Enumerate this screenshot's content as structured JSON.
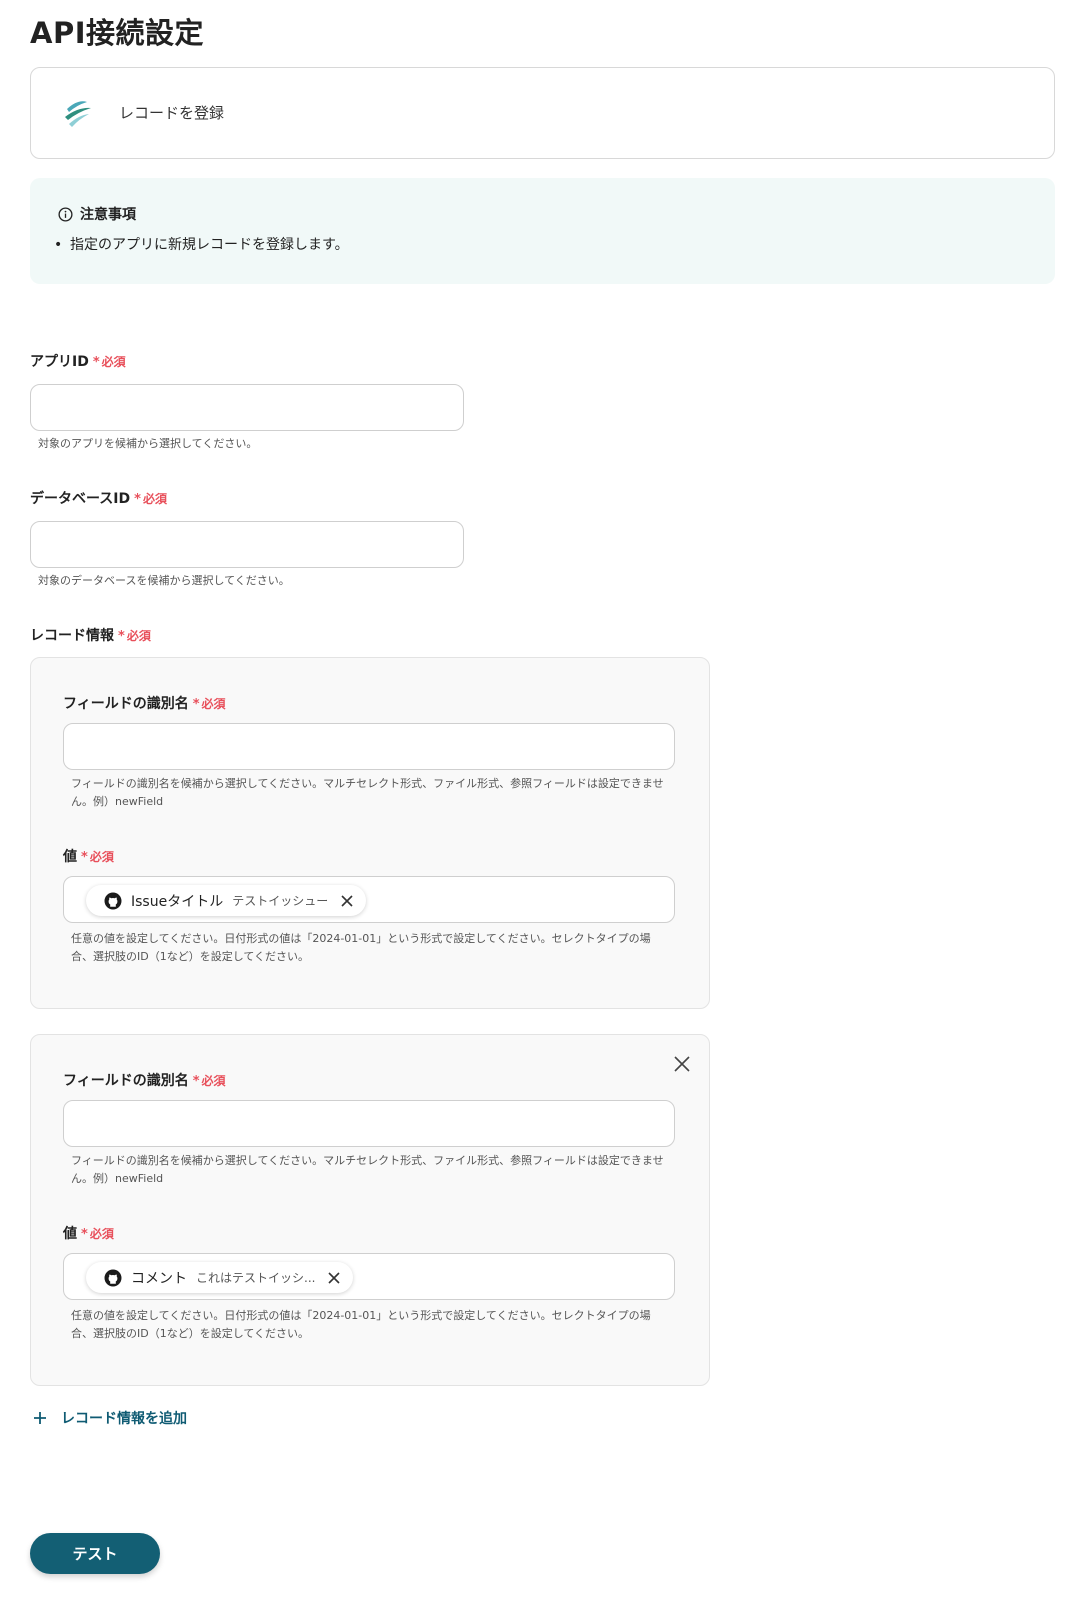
{
  "page_title": "API接続設定",
  "action": {
    "name": "レコードを登録",
    "logo_icon": "kintone-logo-icon"
  },
  "notice": {
    "title": "注意事項",
    "items": [
      "指定のアプリに新規レコードを登録します。"
    ]
  },
  "required_label": "必須",
  "required_mark": "*",
  "app_id": {
    "label": "アプリID",
    "value": "",
    "help": "対象のアプリを候補から選択してください。"
  },
  "database_id": {
    "label": "データベースID",
    "value": "",
    "help": "対象のデータベースを候補から選択してください。"
  },
  "record_info": {
    "label": "レコード情報",
    "groups": [
      {
        "field_label": "フィールドの識別名",
        "field_value": "",
        "field_help": "フィールドの識別名を候補から選択してください。マルチセレクト形式、ファイル形式、参照フィールドは設定できません。例）newField",
        "value_label": "値",
        "value_help": "任意の値を設定してください。日付形式の値は「2024-01-01」という形式で設定してください。セレクトタイプの場合、選択肢のID（1など）を設定してください。",
        "chip": {
          "icon": "github-icon",
          "name": "Issueタイトル",
          "value": "テストイッシュー"
        }
      },
      {
        "field_label": "フィールドの識別名",
        "field_value": "",
        "field_help": "フィールドの識別名を候補から選択してください。マルチセレクト形式、ファイル形式、参照フィールドは設定できません。例）newField",
        "value_label": "値",
        "value_help": "任意の値を設定してください。日付形式の値は「2024-01-01」という形式で設定してください。セレクトタイプの場合、選択肢のID（1など）を設定してください。",
        "chip": {
          "icon": "github-icon",
          "name": "コメント",
          "value": "これはテストイッシ..."
        }
      }
    ],
    "add_label": "レコード情報を追加"
  },
  "test_button_label": "テスト",
  "colors": {
    "accent": "#135f74",
    "required": "#e8505b",
    "notice_bg": "#f1f9f8",
    "group_bg": "#f9f9f9"
  }
}
